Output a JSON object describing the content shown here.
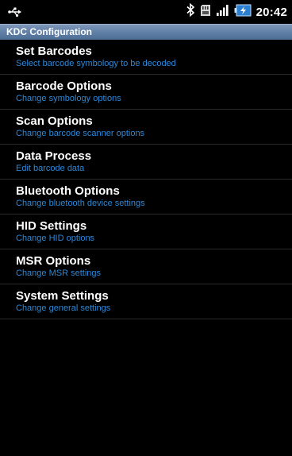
{
  "status_bar": {
    "time": "20:42",
    "icons": [
      "usb-icon",
      "bluetooth-icon",
      "sd-card-icon",
      "signal-icon",
      "battery-icon"
    ]
  },
  "app": {
    "title": "KDC Configuration"
  },
  "menu": {
    "items": [
      {
        "title": "Set Barcodes",
        "subtitle": "Select barcode symbology to be decoded"
      },
      {
        "title": "Barcode Options",
        "subtitle": "Change symbology options"
      },
      {
        "title": "Scan Options",
        "subtitle": "Change barcode scanner options"
      },
      {
        "title": "Data Process",
        "subtitle": "Edit barcode data"
      },
      {
        "title": "Bluetooth Options",
        "subtitle": "Change bluetooth device settings"
      },
      {
        "title": "HID Settings",
        "subtitle": "Change HID options"
      },
      {
        "title": "MSR Options",
        "subtitle": "Change MSR settings"
      },
      {
        "title": "System Settings",
        "subtitle": "Change general settings"
      }
    ]
  },
  "colors": {
    "subtitle": "#2e88d8",
    "title_bar": "#5f7ea5",
    "background": "#000000"
  }
}
